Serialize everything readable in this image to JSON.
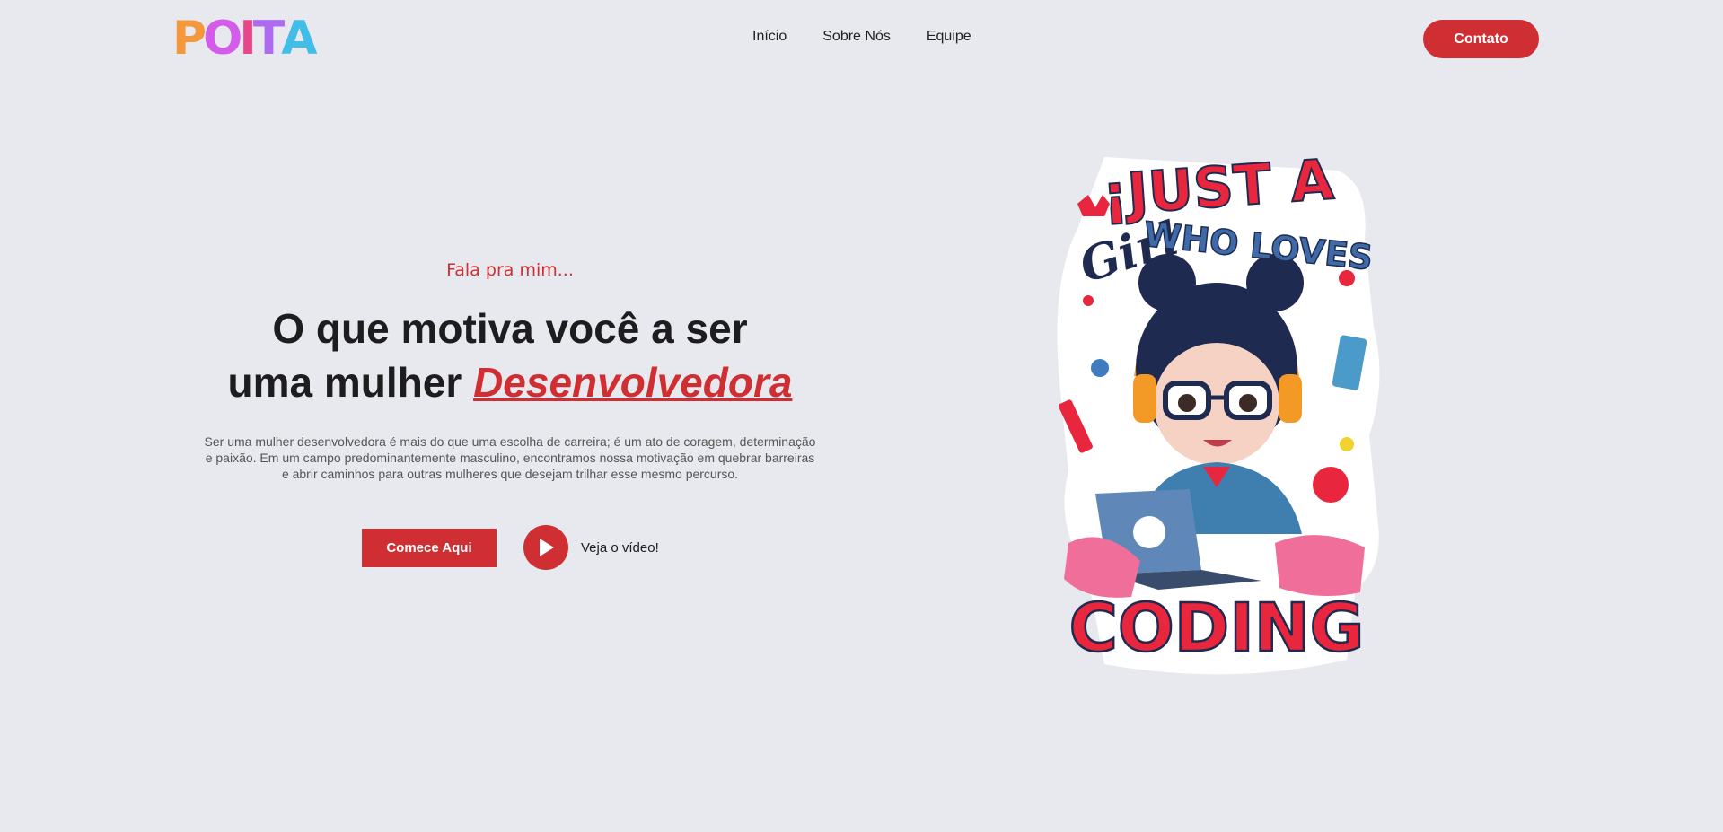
{
  "brand": {
    "logo_letters": [
      {
        "char": "P",
        "color": "#f4983b"
      },
      {
        "char": "O",
        "color": "#d35ce8"
      },
      {
        "char": "I",
        "color": "#e8468a"
      },
      {
        "char": "T",
        "color": "#ad6cf0"
      },
      {
        "char": "A",
        "color": "#42bde8"
      }
    ]
  },
  "nav": {
    "items": [
      {
        "label": "Início"
      },
      {
        "label": "Sobre Nós"
      },
      {
        "label": "Equipe"
      }
    ],
    "contact_label": "Contato"
  },
  "hero": {
    "eyebrow": "Fala pra mim...",
    "headline_line1": "O que motiva você a ser",
    "headline_line2_prefix": "uma mulher ",
    "headline_highlight": "Desenvolvedora",
    "description": "Ser uma mulher desenvolvedora é mais do que uma escolha de carreira; é um ato de coragem, determinação e paixão. Em um campo predominantemente masculino, encontramos nossa motivação em quebrar barreiras e abrir caminhos para outras mulheres que desejam trilhar esse mesmo percurso.",
    "primary_cta": "Comece Aqui",
    "video_cta": "Veja o vídeo!"
  },
  "illustration": {
    "top_text": "¡JUST A",
    "middle_script": "Girl",
    "middle_text": "WHO LOVES",
    "bottom_text": "CODING"
  },
  "colors": {
    "accent": "#cf2f33",
    "background": "#e8e9ee",
    "text_dark": "#1d1d1f",
    "text_muted": "#555555"
  }
}
